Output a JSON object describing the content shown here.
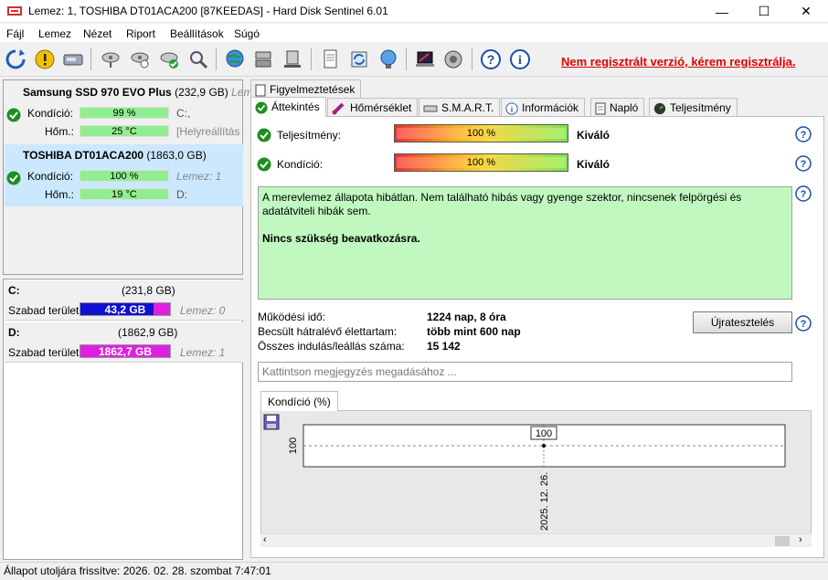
{
  "window": {
    "title": "Lemez: 1, TOSHIBA DT01ACA200 [87KEEDAS]  -  Hard Disk Sentinel 6.01",
    "min": "—",
    "max": "☐",
    "close": "✕"
  },
  "menu": [
    {
      "label": "Fájl"
    },
    {
      "label": "Lemez"
    },
    {
      "label": "Nézet"
    },
    {
      "label": "Riport"
    },
    {
      "label": "Beállítások"
    },
    {
      "label": "Súgó"
    }
  ],
  "toolbar": {
    "register_link": "Nem regisztrált verzió, kérem regisztrálja."
  },
  "disks": [
    {
      "name": "Samsung SSD 970 EVO Plus",
      "size": "(232,9 GB)",
      "trail": "Leme",
      "condition_label": "Kondíció:",
      "condition_value": "99 %",
      "temp_label": "Hőm.:",
      "temp_value": "25 °C",
      "side1": "C:,",
      "side2": "[Helyreállítás"
    },
    {
      "name": "TOSHIBA DT01ACA200",
      "size": "(1863,0 GB)",
      "trail": "",
      "condition_label": "Kondíció:",
      "condition_value": "100 %",
      "temp_label": "Hőm.:",
      "temp_value": "19 °C",
      "side1": "Lemez: 1",
      "side2": "D:"
    }
  ],
  "volumes": [
    {
      "name": "C:",
      "size": "(231,8 GB)",
      "free_label": "Szabad terület",
      "free_value": "43,2 GB",
      "side": "Lemez: 0",
      "fill_fraction": 0.814,
      "fill_color": "#1010d0",
      "rest_color": "#e020e0"
    },
    {
      "name": "D:",
      "size": "(1862,9 GB)",
      "free_label": "Szabad terület",
      "free_value": "1862,7 GB",
      "side": "Lemez: 1",
      "fill_fraction": 1.0,
      "fill_color": "#e020e0",
      "rest_color": "#e020e0"
    }
  ],
  "tabs_top": [
    {
      "label": "Figyelmeztetések"
    }
  ],
  "tabs": [
    {
      "label": "Áttekintés"
    },
    {
      "label": "Hőmérséklet"
    },
    {
      "label": "S.M.A.R.T."
    },
    {
      "label": "Információk"
    },
    {
      "label": "Napló"
    },
    {
      "label": "Teljesítmény"
    }
  ],
  "overview": {
    "performance_label": "Teljesítmény:",
    "performance_value": "100 %",
    "performance_rating": "Kiváló",
    "condition_label": "Kondíció:",
    "condition_value": "100 %",
    "condition_rating": "Kiváló",
    "status_text": "A merevlemez állapota hibátlan. Nem található hibás vagy gyenge szektor, nincsenek felpörgési és adatátviteli hibák sem.",
    "status_bold": "Nincs szükség beavatkozásra.",
    "uptime_label": "Működési idő:",
    "uptime_value": "1224 nap, 8 óra",
    "lifetime_label": "Becsült hátralévő élettartam:",
    "lifetime_value": "több mint 600 nap",
    "startstop_label": "Összes indulás/leállás száma:",
    "startstop_value": "15 142",
    "retest_button": "Újratesztelés",
    "note_placeholder": "Kattintson megjegyzés megadásához ...",
    "chart_tab": "Kondíció  (%)"
  },
  "chart_data": {
    "type": "line",
    "x": [
      "2025. 12. 26."
    ],
    "series": [
      {
        "values": [
          100
        ]
      }
    ],
    "title": "Kondíció  (%)",
    "xlabel": "",
    "ylabel": "",
    "yticks": [
      "100"
    ],
    "data_labels": [
      "100"
    ],
    "grid": true
  },
  "status_bar": "Állapot utoljára frissítve: 2026. 02. 28. szombat 7:47:01",
  "colors": {
    "register_link": "#e00000",
    "selected_disk": "#cce8ff",
    "condition_bar": "#90ee90",
    "status_box": "#c0f8c0"
  }
}
